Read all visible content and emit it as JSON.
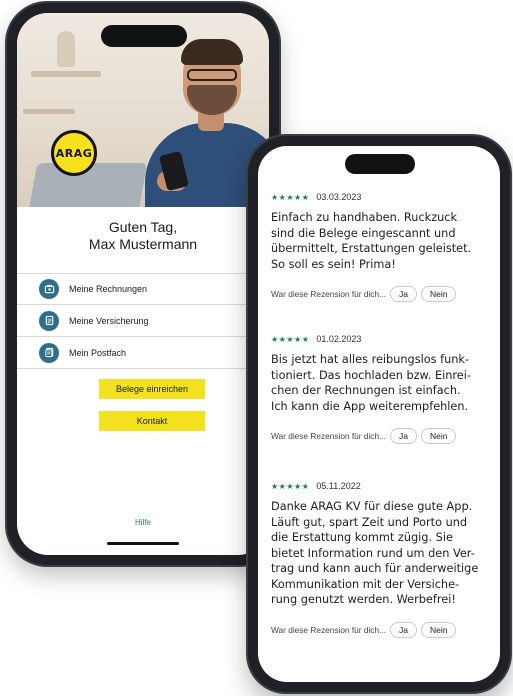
{
  "app": {
    "logo_text": "ARAG",
    "greeting_line1": "Guten Tag,",
    "greeting_line2": "Max Mustermann",
    "menu": [
      {
        "label": "Meine Rechnungen",
        "icon": "invoice-icon"
      },
      {
        "label": "Meine Versicherung",
        "icon": "policy-icon"
      },
      {
        "label": "Mein Postfach",
        "icon": "mailbox-icon"
      }
    ],
    "buttons": {
      "belege": "Belege einreichen",
      "kontakt": "Kontakt"
    },
    "help_link": "Hilfe",
    "accent_color": "#f4e21e",
    "icon_color": "#2f6e8b"
  },
  "reviews": {
    "star_color": "#1e7a54",
    "stars_glyph": "★★★★★",
    "question": "War diese Rezension für dich...",
    "yes_label": "Ja",
    "no_label": "Nein",
    "items": [
      {
        "date": "03.03.2023",
        "lines": [
          "Einfach zu handhaben. Ruckzuck",
          "sind die Belege eingescannt und",
          "übermittelt, Erstattungen geleistet.",
          "So soll es sein! Prima!"
        ]
      },
      {
        "date": "01.02.2023",
        "lines": [
          "Bis jetzt hat alles reibungslos funk-",
          "tioniert. Das hochladen bzw. Einrei-",
          "chen der Rechnungen ist einfach.",
          "Ich kann die App weiterempfehlen."
        ]
      },
      {
        "date": "05.11.2022",
        "lines": [
          "Danke ARAG KV für diese gute App.",
          "Läuft gut, spart Zeit und Porto und",
          "die Erstattung kommt zügig. Sie",
          "bietet Information rund um den Ver-",
          "trag und kann auch für anderweitige",
          "Kommunikation mit der Versiche-",
          "rung genutzt werden. Werbefrei!"
        ]
      }
    ]
  }
}
